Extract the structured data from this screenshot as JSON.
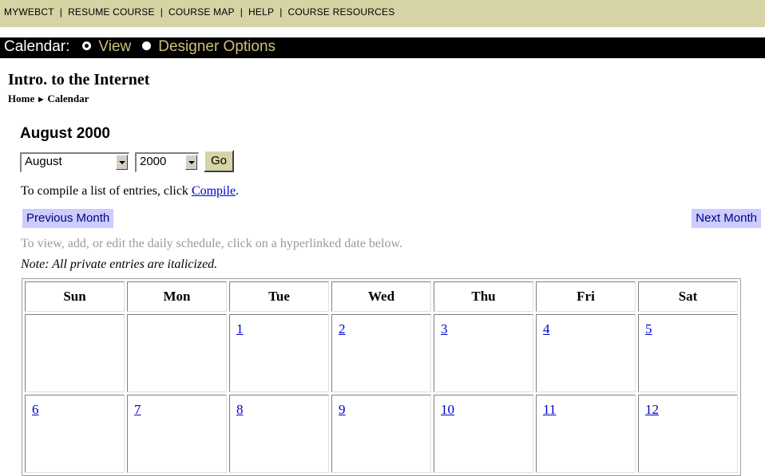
{
  "topnav": {
    "items": [
      "MYWEBCT",
      "RESUME COURSE",
      "COURSE MAP",
      "HELP",
      "COURSE RESOURCES"
    ],
    "separator": "|"
  },
  "calbar": {
    "label": "Calendar:",
    "options": [
      {
        "label": "View",
        "selected": true
      },
      {
        "label": "Designer Options",
        "selected": false
      }
    ]
  },
  "course": {
    "title": "Intro. to the Internet"
  },
  "breadcrumb": {
    "home": "Home",
    "current": "Calendar",
    "arrow": "▶"
  },
  "month_heading": "August 2000",
  "selectors": {
    "month": "August",
    "year": "2000",
    "go_label": "Go"
  },
  "compile": {
    "prefix": "To compile a list of entries, click ",
    "link": "Compile",
    "suffix": "."
  },
  "month_nav": {
    "previous": "Previous Month",
    "next": "Next Month"
  },
  "instructions": "To view, add, or edit the daily schedule, click on a hyperlinked date below.",
  "note": "Note: All private entries are italicized.",
  "calendar": {
    "weekdays": [
      "Sun",
      "Mon",
      "Tue",
      "Wed",
      "Thu",
      "Fri",
      "Sat"
    ],
    "weeks": [
      [
        "",
        "",
        "1",
        "2",
        "3",
        "4",
        "5"
      ],
      [
        "6",
        "7",
        "8",
        "9",
        "10",
        "11",
        "12"
      ]
    ]
  },
  "colors": {
    "topnav_bg": "#d6d3a5",
    "calbar_bg": "#000000",
    "calbar_option": "#c9c07a",
    "link": "#0000cc",
    "month_nav_bg": "#ccccff",
    "instruction_text": "#999999"
  }
}
